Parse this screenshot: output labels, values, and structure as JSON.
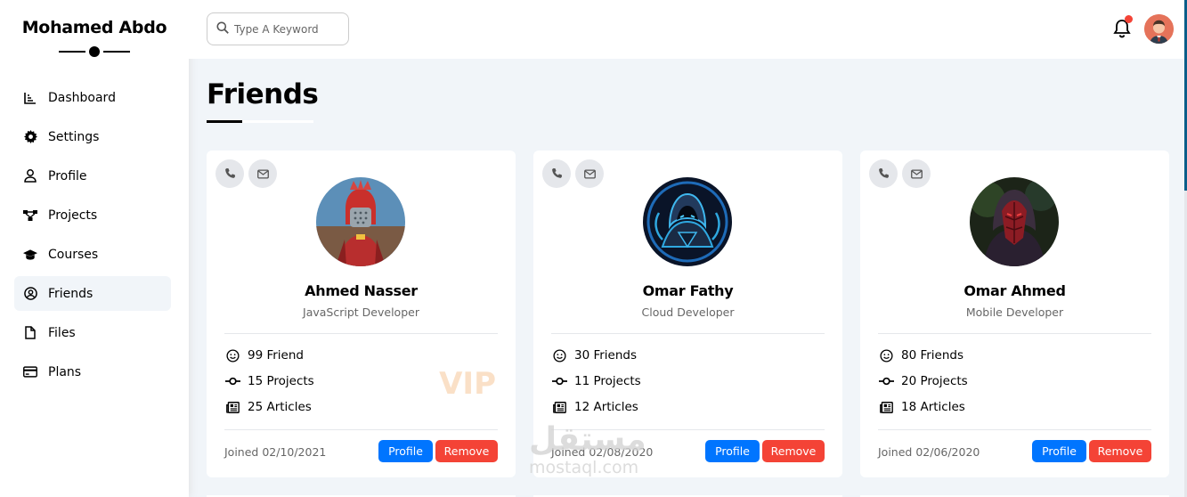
{
  "sidebar": {
    "brand": "Mohamed Abdo",
    "items": [
      {
        "label": "Dashboard",
        "icon": "chart-icon"
      },
      {
        "label": "Settings",
        "icon": "gear-icon"
      },
      {
        "label": "Profile",
        "icon": "user-icon"
      },
      {
        "label": "Projects",
        "icon": "diagram-icon"
      },
      {
        "label": "Courses",
        "icon": "graduation-cap-icon"
      },
      {
        "label": "Friends",
        "icon": "user-circle-icon",
        "active": true
      },
      {
        "label": "Files",
        "icon": "file-icon"
      },
      {
        "label": "Plans",
        "icon": "credit-card-icon"
      }
    ]
  },
  "header": {
    "search_placeholder": "Type A Keyword",
    "notification_badge_color": "#f44336"
  },
  "page": {
    "title": "Friends"
  },
  "cards": [
    {
      "name": "Ahmed Nasser",
      "role": "JavaScript Developer",
      "friends": "99 Friend",
      "projects": "15 Projects",
      "articles": "25 Articles",
      "badge": "VIP",
      "joined": "Joined 02/10/2021",
      "profile_label": "Profile",
      "remove_label": "Remove"
    },
    {
      "name": "Omar Fathy",
      "role": "Cloud Developer",
      "friends": "30 Friends",
      "projects": "11 Projects",
      "articles": "12 Articles",
      "joined": "Joined 02/08/2020",
      "profile_label": "Profile",
      "remove_label": "Remove"
    },
    {
      "name": "Omar Ahmed",
      "role": "Mobile Developer",
      "friends": "80 Friends",
      "projects": "20 Projects",
      "articles": "18 Articles",
      "joined": "Joined 02/06/2020",
      "profile_label": "Profile",
      "remove_label": "Remove"
    }
  ],
  "colors": {
    "primary": "#0075ff",
    "danger": "#f44336",
    "background": "#f1f5f9"
  },
  "watermark": {
    "arabic": "مستقل",
    "latin": "mostaql.com"
  }
}
